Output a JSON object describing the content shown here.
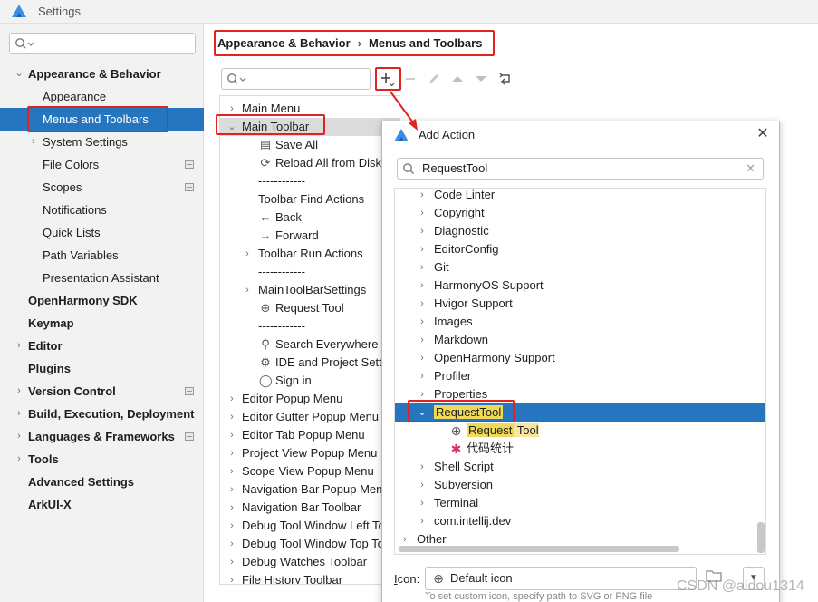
{
  "window": {
    "title": "Settings"
  },
  "sidebar": {
    "search_placeholder": "",
    "items": [
      {
        "label": "Appearance & Behavior",
        "level": 0,
        "bold": true,
        "arrow": "⌄"
      },
      {
        "label": "Appearance",
        "level": 1
      },
      {
        "label": "Menus and Toolbars",
        "level": 1,
        "selected": true
      },
      {
        "label": "System Settings",
        "level": 1,
        "arrow": "›"
      },
      {
        "label": "File Colors",
        "level": 1,
        "mini": true
      },
      {
        "label": "Scopes",
        "level": 1,
        "mini": true
      },
      {
        "label": "Notifications",
        "level": 1
      },
      {
        "label": "Quick Lists",
        "level": 1
      },
      {
        "label": "Path Variables",
        "level": 1
      },
      {
        "label": "Presentation Assistant",
        "level": 1
      },
      {
        "label": "OpenHarmony SDK",
        "level": 0,
        "bold": true
      },
      {
        "label": "Keymap",
        "level": 0,
        "bold": true
      },
      {
        "label": "Editor",
        "level": 0,
        "bold": true,
        "arrow": "›"
      },
      {
        "label": "Plugins",
        "level": 0,
        "bold": true
      },
      {
        "label": "Version Control",
        "level": 0,
        "bold": true,
        "arrow": "›",
        "mini": true
      },
      {
        "label": "Build, Execution, Deployment",
        "level": 0,
        "bold": true,
        "arrow": "›"
      },
      {
        "label": "Languages & Frameworks",
        "level": 0,
        "bold": true,
        "arrow": "›",
        "mini": true
      },
      {
        "label": "Tools",
        "level": 0,
        "bold": true,
        "arrow": "›"
      },
      {
        "label": "Advanced Settings",
        "level": 0,
        "bold": true
      },
      {
        "label": "ArkUI-X",
        "level": 0,
        "bold": true
      }
    ]
  },
  "breadcrumb": {
    "parent": "Appearance & Behavior",
    "separator": "›",
    "current": "Menus and Toolbars"
  },
  "toolbar": {
    "search_placeholder": "",
    "icons": [
      "add-icon",
      "remove-icon",
      "edit-icon",
      "move-up-icon",
      "move-down-icon",
      "restore-icon"
    ]
  },
  "actions_tree": [
    {
      "label": "Main Menu",
      "level": 0,
      "arrow": "›"
    },
    {
      "label": "Main Toolbar",
      "level": 0,
      "arrow": "⌄",
      "highlighted": true
    },
    {
      "label": "Save All",
      "level": 1,
      "icon": "save-icon",
      "glyph": "▤"
    },
    {
      "label": "Reload All from Disk",
      "level": 1,
      "icon": "reload-icon",
      "glyph": "⟳"
    },
    {
      "label": "------------",
      "level": 1
    },
    {
      "label": "Toolbar Find Actions",
      "level": 1
    },
    {
      "label": "Back",
      "level": 1,
      "icon": "back-arrow-icon",
      "glyph": "←"
    },
    {
      "label": "Forward",
      "level": 1,
      "icon": "forward-arrow-icon",
      "glyph": "→"
    },
    {
      "label": "Toolbar Run Actions",
      "level": 1,
      "arrow": "›"
    },
    {
      "label": "------------",
      "level": 1
    },
    {
      "label": "MainToolBarSettings",
      "level": 1,
      "arrow": "›"
    },
    {
      "label": "Request Tool",
      "level": 1,
      "icon": "default-action-icon",
      "glyph": "⊕"
    },
    {
      "label": "------------",
      "level": 1
    },
    {
      "label": "Search Everywhere",
      "level": 1,
      "icon": "search-icon",
      "glyph": "⚲"
    },
    {
      "label": "IDE and Project Settings",
      "level": 1,
      "icon": "gear-icon",
      "glyph": "⚙"
    },
    {
      "label": "Sign in",
      "level": 1,
      "icon": "user-icon",
      "glyph": "◯"
    },
    {
      "label": "Editor Popup Menu",
      "level": 0,
      "arrow": "›"
    },
    {
      "label": "Editor Gutter Popup Menu",
      "level": 0,
      "arrow": "›"
    },
    {
      "label": "Editor Tab Popup Menu",
      "level": 0,
      "arrow": "›"
    },
    {
      "label": "Project View Popup Menu",
      "level": 0,
      "arrow": "›"
    },
    {
      "label": "Scope View Popup Menu",
      "level": 0,
      "arrow": "›"
    },
    {
      "label": "Navigation Bar Popup Menu",
      "level": 0,
      "arrow": "›"
    },
    {
      "label": "Navigation Bar Toolbar",
      "level": 0,
      "arrow": "›"
    },
    {
      "label": "Debug Tool Window Left Toolbar",
      "level": 0,
      "arrow": "›"
    },
    {
      "label": "Debug Tool Window Top Toolbar",
      "level": 0,
      "arrow": "›"
    },
    {
      "label": "Debug Watches Toolbar",
      "level": 0,
      "arrow": "›"
    },
    {
      "label": "File History Toolbar",
      "level": 0,
      "arrow": "›"
    }
  ],
  "dialog": {
    "title": "Add Action",
    "search_value": "RequestTool",
    "tree": [
      {
        "label": "Code Linter",
        "level": 1,
        "arrow": "›"
      },
      {
        "label": "Copyright",
        "level": 1,
        "arrow": "›"
      },
      {
        "label": "Diagnostic",
        "level": 1,
        "arrow": "›"
      },
      {
        "label": "EditorConfig",
        "level": 1,
        "arrow": "›"
      },
      {
        "label": "Git",
        "level": 1,
        "arrow": "›"
      },
      {
        "label": "HarmonyOS Support",
        "level": 1,
        "arrow": "›"
      },
      {
        "label": "Hvigor Support",
        "level": 1,
        "arrow": "›"
      },
      {
        "label": "Images",
        "level": 1,
        "arrow": "›"
      },
      {
        "label": "Markdown",
        "level": 1,
        "arrow": "›"
      },
      {
        "label": "OpenHarmony Support",
        "level": 1,
        "arrow": "›"
      },
      {
        "label": "Profiler",
        "level": 1,
        "arrow": "›"
      },
      {
        "label": "Properties",
        "level": 1,
        "arrow": "›"
      },
      {
        "label": "RequestTool",
        "level": 1,
        "arrow": "⌄",
        "selected": true
      },
      {
        "label": "Request Tool",
        "level": 2,
        "icon": "default-action-icon",
        "glyph": "⊕",
        "match_a": "Request",
        "match_b": " Tool"
      },
      {
        "label": "代码统计",
        "level": 2,
        "icon": "slack-icon",
        "glyph": "✱"
      },
      {
        "label": "Shell Script",
        "level": 1,
        "arrow": "›"
      },
      {
        "label": "Subversion",
        "level": 1,
        "arrow": "›"
      },
      {
        "label": "Terminal",
        "level": 1,
        "arrow": "›"
      },
      {
        "label": "com.intellij.dev",
        "level": 1,
        "arrow": "›"
      },
      {
        "label": "Other",
        "level": 0,
        "arrow": "›"
      }
    ],
    "icon_label_prefix": "I",
    "icon_label_rest": "con:",
    "icon_value": "Default icon",
    "hint": "To set custom icon, specify path to SVG or PNG file"
  },
  "watermark": "CSDN @aidou1314",
  "colors": {
    "selection": "#2675bf",
    "annotation_red": "#e0231e",
    "match_highlight": "#f0d85a"
  }
}
